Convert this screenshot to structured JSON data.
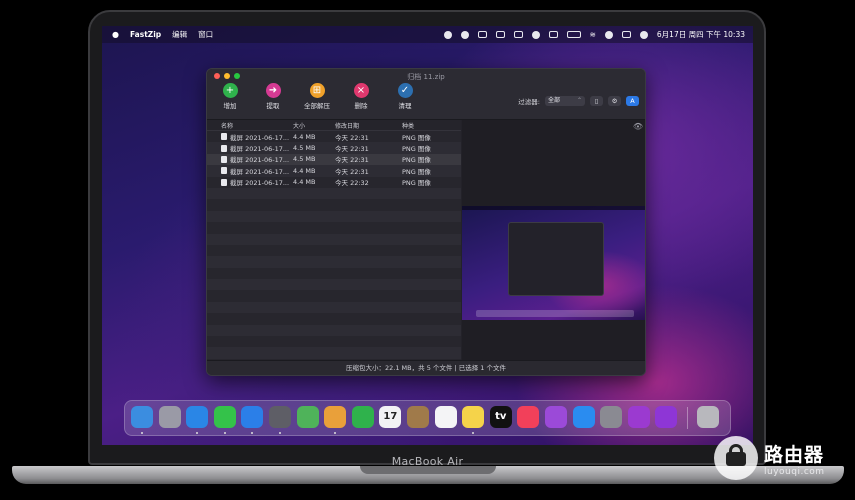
{
  "device": {
    "model_label": "MacBook Air"
  },
  "menubar": {
    "app_name": "FastZip",
    "menus": [
      "编辑",
      "窗口"
    ],
    "datetime": "6月17日 周四 下午 10:33"
  },
  "window": {
    "title": "归档 11.zip",
    "toolbar": [
      {
        "label": "增加",
        "icon": "plus-icon",
        "color": "#2fb24c",
        "glyph": "+"
      },
      {
        "label": "提取",
        "icon": "arrow-right-icon",
        "color": "#d53a93",
        "glyph": "➜"
      },
      {
        "label": "全部解压",
        "icon": "extract-all-icon",
        "color": "#f0a12a",
        "glyph": "⊞"
      },
      {
        "label": "删除",
        "icon": "delete-icon",
        "color": "#e0386e",
        "glyph": "×"
      },
      {
        "label": "清理",
        "icon": "clean-icon",
        "color": "#2c6fb0",
        "glyph": "✓"
      }
    ],
    "filter": {
      "label": "过滤器:",
      "value": "全部"
    },
    "columns": {
      "name": "名称",
      "size": "大小",
      "modified": "修改日期",
      "kind": "种类"
    },
    "files": [
      {
        "name": "截屏 2021-06-17...",
        "size": "4.4 MB",
        "modified": "今天 22:31",
        "kind": "PNG 图像",
        "selected": false
      },
      {
        "name": "截屏 2021-06-17...",
        "size": "4.5 MB",
        "modified": "今天 22:31",
        "kind": "PNG 图像",
        "selected": false
      },
      {
        "name": "截屏 2021-06-17...",
        "size": "4.5 MB",
        "modified": "今天 22:31",
        "kind": "PNG 图像",
        "selected": true
      },
      {
        "name": "截屏 2021-06-17...",
        "size": "4.4 MB",
        "modified": "今天 22:31",
        "kind": "PNG 图像",
        "selected": false
      },
      {
        "name": "截屏 2021-06-17...",
        "size": "4.4 MB",
        "modified": "今天 22:32",
        "kind": "PNG 图像",
        "selected": false
      }
    ],
    "status": "压缩包大小：22.1 MB，共 5 个文件 | 已选择 1 个文件"
  },
  "dock": {
    "apps": [
      {
        "name": "finder-icon",
        "color": "#3b8de0"
      },
      {
        "name": "launchpad-icon",
        "color": "#9a9aa6"
      },
      {
        "name": "safari-icon",
        "color": "#2a86e6"
      },
      {
        "name": "messages-icon",
        "color": "#34c24a"
      },
      {
        "name": "mail-icon",
        "color": "#2b7fe8"
      },
      {
        "name": "screenshot-icon",
        "color": "#5e5e66"
      },
      {
        "name": "maps-icon",
        "color": "#4fb35a"
      },
      {
        "name": "photos-icon",
        "color": "#e9a03a"
      },
      {
        "name": "facetime-icon",
        "color": "#2fb24c"
      },
      {
        "name": "calendar-icon",
        "color": "#f2f2f4",
        "text": "17"
      },
      {
        "name": "contacts-icon",
        "color": "#a07a4a"
      },
      {
        "name": "reminders-icon",
        "color": "#f4f4f6"
      },
      {
        "name": "notes-icon",
        "color": "#f5d34a"
      },
      {
        "name": "tv-icon",
        "color": "#111",
        "text": "tv"
      },
      {
        "name": "music-icon",
        "color": "#f2405a"
      },
      {
        "name": "podcasts-icon",
        "color": "#9b4ad8"
      },
      {
        "name": "app-store-icon",
        "color": "#2a8cf0"
      },
      {
        "name": "system-preferences-icon",
        "color": "#8a8a92"
      },
      {
        "name": "feedback-icon",
        "color": "#9b3ad0"
      },
      {
        "name": "shortcuts-icon",
        "color": "#8e36d6"
      },
      {
        "name": "trash-icon",
        "color": "#b8b8bd"
      }
    ]
  },
  "watermark": {
    "title": "路由器",
    "subtitle": "luyouqi.com"
  }
}
